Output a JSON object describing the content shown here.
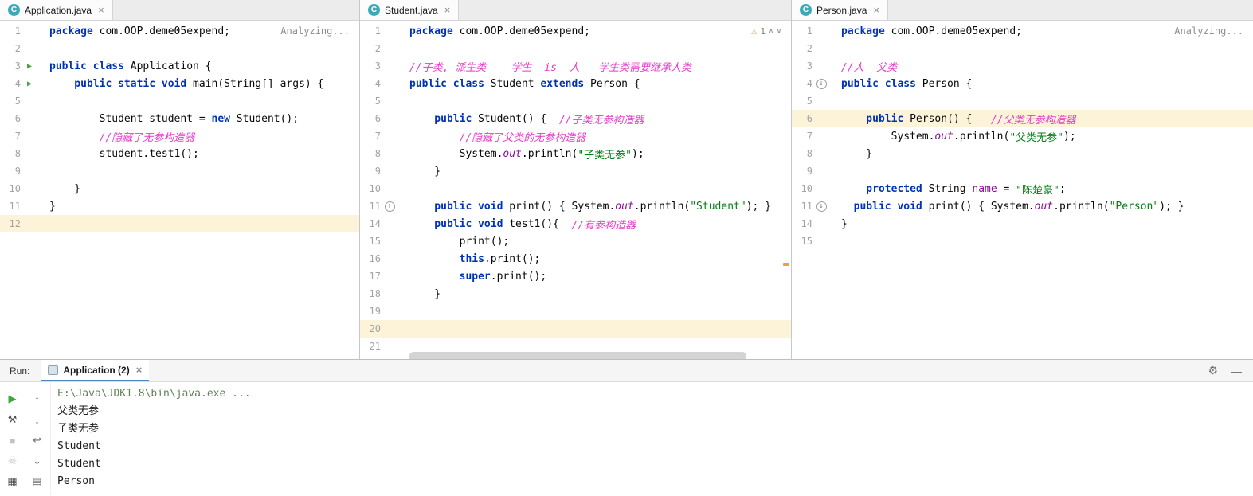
{
  "theme": {
    "keyword_color": "#0033B3",
    "comment_color": "#E83CC8",
    "string_color": "#067D17",
    "field_color": "#871094",
    "caret_line_color": "#FCF3D9",
    "run_green": "#3EA63E",
    "warning_color": "#E8A33D",
    "class_icon_color": "#3BAAB8"
  },
  "icons": {
    "run_triangle": "▶",
    "arrow_up": "↑",
    "arrow_down": "↓",
    "warning": "⚠",
    "chevron_up": "∧",
    "chevron_down": "∨",
    "gear": "⚙",
    "minimize": "—"
  },
  "inspection": {
    "warn_count": "1"
  },
  "editor": {
    "analyzing_label": "Analyzing...",
    "panes": [
      {
        "tab": {
          "title": "Application.java",
          "close": "×",
          "icon_letter": "C"
        },
        "lines": [
          {
            "n": 1,
            "t": [
              [
                "kw",
                "package"
              ],
              [
                "pl",
                " com.OOP.deme05expend;"
              ]
            ],
            "right": "analyzing"
          },
          {
            "n": 2,
            "t": []
          },
          {
            "n": 3,
            "t": [
              [
                "kw",
                "public class"
              ],
              [
                "pl",
                " Application {"
              ]
            ],
            "icon": "run"
          },
          {
            "n": 4,
            "t": [
              [
                "kw",
                "    public static void"
              ],
              [
                "pl",
                " main(String[] args) {"
              ]
            ],
            "icon": "run"
          },
          {
            "n": 5,
            "t": []
          },
          {
            "n": 6,
            "t": [
              [
                "pl",
                "        Student student = "
              ],
              [
                "kw",
                "new"
              ],
              [
                "pl",
                " Student();"
              ]
            ]
          },
          {
            "n": 7,
            "t": [
              [
                "cm",
                "        //隐藏了无参构造器"
              ]
            ]
          },
          {
            "n": 8,
            "t": [
              [
                "pl",
                "        student.test1();"
              ]
            ]
          },
          {
            "n": 9,
            "t": []
          },
          {
            "n": 10,
            "t": [
              [
                "pl",
                "    }"
              ]
            ]
          },
          {
            "n": 11,
            "t": [
              [
                "pl",
                "}"
              ]
            ]
          },
          {
            "n": 12,
            "t": [],
            "hl": true
          }
        ]
      },
      {
        "tab": {
          "title": "Student.java",
          "close": "×",
          "icon_letter": "C"
        },
        "partial_bar": true,
        "lines": [
          {
            "n": 1,
            "t": [
              [
                "kw",
                "package"
              ],
              [
                "pl",
                " com.OOP.deme05expend;"
              ]
            ],
            "right": "inspect"
          },
          {
            "n": 2,
            "t": []
          },
          {
            "n": 3,
            "t": [
              [
                "cm",
                "//子类, 派生类    学生  is  人   学生类需要继承人类"
              ]
            ]
          },
          {
            "n": 4,
            "t": [
              [
                "kw",
                "public class"
              ],
              [
                "pl",
                " Student "
              ],
              [
                "kw",
                "extends"
              ],
              [
                "pl",
                " Person {"
              ]
            ]
          },
          {
            "n": 5,
            "t": []
          },
          {
            "n": 6,
            "t": [
              [
                "kw",
                "    public"
              ],
              [
                "pl",
                " Student() {  "
              ],
              [
                "cm",
                "//子类无参构造器"
              ]
            ]
          },
          {
            "n": 7,
            "t": [
              [
                "cm",
                "        //隐藏了父类的无参构造器"
              ]
            ]
          },
          {
            "n": 8,
            "t": [
              [
                "pl",
                "        System."
              ],
              [
                "fld",
                "out"
              ],
              [
                "pl",
                ".println("
              ],
              [
                "str",
                "\"子类无参\""
              ],
              [
                "pl",
                ");"
              ]
            ]
          },
          {
            "n": 9,
            "t": [
              [
                "pl",
                "    }"
              ]
            ]
          },
          {
            "n": 10,
            "t": []
          },
          {
            "n": 11,
            "t": [
              [
                "kw",
                "    public void"
              ],
              [
                "pl",
                " print() { System."
              ],
              [
                "fld",
                "out"
              ],
              [
                "pl",
                ".println("
              ],
              [
                "str",
                "\"Student\""
              ],
              [
                "pl",
                "); }"
              ]
            ],
            "icon": "ovr-up"
          },
          {
            "n": 14,
            "t": [
              [
                "kw",
                "    public void"
              ],
              [
                "pl",
                " test1(){  "
              ],
              [
                "cm",
                "//有参构造器"
              ]
            ]
          },
          {
            "n": 15,
            "t": [
              [
                "pl",
                "        print();"
              ]
            ]
          },
          {
            "n": 16,
            "t": [
              [
                "kw",
                "        this"
              ],
              [
                "pl",
                ".print();"
              ]
            ]
          },
          {
            "n": 17,
            "t": [
              [
                "kw",
                "        super"
              ],
              [
                "pl",
                ".print();"
              ]
            ]
          },
          {
            "n": 18,
            "t": [
              [
                "pl",
                "    }"
              ]
            ]
          },
          {
            "n": 19,
            "t": []
          },
          {
            "n": 20,
            "t": [],
            "hl": true
          },
          {
            "n": 21,
            "t": []
          }
        ]
      },
      {
        "tab": {
          "title": "Person.java",
          "close": "×",
          "icon_letter": "C"
        },
        "lines": [
          {
            "n": 1,
            "t": [
              [
                "kw",
                "package"
              ],
              [
                "pl",
                " com.OOP.deme05expend;"
              ]
            ],
            "right": "analyzing"
          },
          {
            "n": 2,
            "t": []
          },
          {
            "n": 3,
            "t": [
              [
                "cm",
                "//人  父类"
              ]
            ]
          },
          {
            "n": 4,
            "t": [
              [
                "kw",
                "public class"
              ],
              [
                "pl",
                " Person {"
              ]
            ],
            "icon": "ovr-down"
          },
          {
            "n": 5,
            "t": []
          },
          {
            "n": 6,
            "t": [
              [
                "kw",
                "    public"
              ],
              [
                "pl",
                " Person() {   "
              ],
              [
                "cm",
                "//父类无参构造器"
              ]
            ],
            "hl": true
          },
          {
            "n": 7,
            "t": [
              [
                "pl",
                "        System."
              ],
              [
                "fld",
                "out"
              ],
              [
                "pl",
                ".println("
              ],
              [
                "str",
                "\"父类无参\""
              ],
              [
                "pl",
                ");"
              ]
            ]
          },
          {
            "n": 8,
            "t": [
              [
                "pl",
                "    }"
              ]
            ]
          },
          {
            "n": 9,
            "t": []
          },
          {
            "n": 10,
            "t": [
              [
                "kw",
                "    protected"
              ],
              [
                "pl",
                " String "
              ],
              [
                "fld2",
                "name"
              ],
              [
                "pl",
                " = "
              ],
              [
                "str",
                "\"陈楚豪\""
              ],
              [
                "pl",
                ";"
              ]
            ]
          },
          {
            "n": 11,
            "t": [
              [
                "kw",
                "  public void"
              ],
              [
                "pl",
                " print() { System."
              ],
              [
                "fld",
                "out"
              ],
              [
                "pl",
                ".println("
              ],
              [
                "str",
                "\"Person\""
              ],
              [
                "pl",
                "); }"
              ]
            ],
            "icon": "ovr-down"
          },
          {
            "n": 14,
            "t": [
              [
                "pl",
                "}"
              ]
            ]
          },
          {
            "n": 15,
            "t": []
          }
        ]
      }
    ]
  },
  "run": {
    "label": "Run:",
    "tab_title": "Application (2)",
    "close": "×",
    "console": [
      {
        "type": "cmd",
        "text": "E:\\Java\\JDK1.8\\bin\\java.exe ..."
      },
      {
        "type": "out",
        "text": "父类无参"
      },
      {
        "type": "out",
        "text": "子类无参"
      },
      {
        "type": "out",
        "text": "Student"
      },
      {
        "type": "out",
        "text": "Student"
      },
      {
        "type": "out",
        "text": "Person"
      }
    ],
    "toolbar_col1": [
      {
        "name": "rerun-icon",
        "glyph": "▶",
        "cls": "ic-green"
      },
      {
        "name": "wrench-icon",
        "glyph": "⚒",
        "cls": "ic-dark"
      },
      {
        "name": "stop-icon",
        "glyph": "■",
        "cls": "ic-pale"
      },
      {
        "name": "kill-process-icon",
        "glyph": "☠",
        "cls": "ic-pale"
      },
      {
        "name": "tool-windows-icon",
        "glyph": "▦",
        "cls": "ic-dark"
      }
    ],
    "toolbar_col2": [
      {
        "name": "up-stack-trace-icon",
        "glyph": "↑",
        "cls": "ic-gray"
      },
      {
        "name": "down-stack-trace-icon",
        "glyph": "↓",
        "cls": "ic-gray"
      },
      {
        "name": "soft-wrap-icon",
        "glyph": "↩",
        "cls": "ic-gray"
      },
      {
        "name": "scroll-to-end-icon",
        "glyph": "⇣",
        "cls": "ic-gray"
      },
      {
        "name": "print-icon",
        "glyph": "▤",
        "cls": "ic-gray"
      }
    ]
  }
}
